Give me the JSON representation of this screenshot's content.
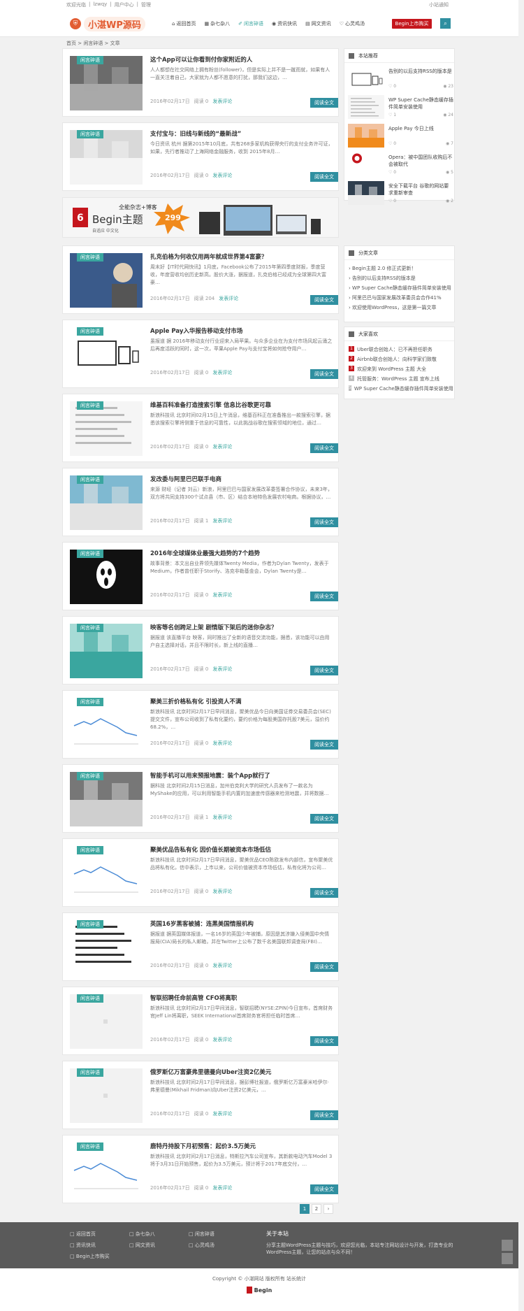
{
  "topbar": {
    "links": [
      "欢迎光临",
      "|",
      "lzwqy",
      "|",
      "用户中心",
      "|",
      "管理"
    ],
    "right": "小站通知"
  },
  "brand": {
    "logo_text": "小湛WP源码",
    "shield": "⛨"
  },
  "nav": [
    {
      "label": "返回首页",
      "icon": "⌂",
      "active": false
    },
    {
      "label": "杂七杂八",
      "icon": "▦",
      "active": false
    },
    {
      "label": "闲言碎语",
      "icon": "✐",
      "active": true
    },
    {
      "label": "资讯快讯",
      "icon": "◉",
      "active": false
    },
    {
      "label": "网文资讯",
      "icon": "▤",
      "active": false
    },
    {
      "label": "心灵鸡汤",
      "icon": "♡",
      "active": false
    }
  ],
  "buy_button": "Begin上市购买",
  "search_icon": "⌕",
  "breadcrumb": "首页 > 闲言碎语 > 文章",
  "posts": [
    {
      "cat": "闲言碎语",
      "title": "这个App可以让你看到付你家附近的人",
      "excerpt": "人人都想在社交网络上拥有粉丝(follower)，但是实际上并不是一蹴而就，如果有人一直关注着自己，大家就为人都不愿意的打扰，那我们这边，…",
      "date": "2016年02月17日",
      "reads": "阅读 0",
      "comments": "发表评论",
      "more": "阅读全文",
      "thumb": "crowd"
    },
    {
      "cat": "闲言碎语",
      "title": "支付宝与：旧线与新线的“最新战”",
      "excerpt": "今日资讯 杭州 据第2015年10月底，共有268多家机构获得央行的支付业务许可证，如果，先行者推动了上海网络金融服务，收到 2015年8月…",
      "date": "2016年02月17日",
      "reads": "阅读 0",
      "comments": "发表评论",
      "more": "阅读全文",
      "thumb": "hand"
    },
    {
      "cat": "闲言碎语",
      "title": "扎克伯格为何收仅用两年就成世界第4富豪？",
      "excerpt": "周末好【IT时代网快讯】1月底，Facebook公布了2015年第四季度财报，季度营收，年度营收均创历史新高。股价大涨，据报道，扎克伯格已经成为全球第四大富豪…",
      "date": "2016年02月17日",
      "reads": "阅读 204",
      "comments": "发表评论",
      "more": "阅读全文",
      "thumb": "zuck"
    },
    {
      "cat": "闲言碎语",
      "title": "Apple Pay入华报告移动支付市场",
      "excerpt": "虽报道 据 2016年移动支付行业迎来入局苹果。与众多企业在为支付市场风起云涌之后再度活跃的同时，这一次，苹果Apple Pay与支付宝将如何抢夺用户…",
      "date": "2016年02月17日",
      "reads": "阅读 0",
      "comments": "发表评论",
      "more": "阅读全文",
      "thumb": "devices"
    },
    {
      "cat": "闲言碎语",
      "title": "维基百科准备打造搜索引擎 信息比谷歌更可靠",
      "excerpt": "新浪科技讯 北京时间02月15日上午消息，维基百科正在准备推出一款搜索引擎，据悉该搜索引擎将侧重于信息的可靠性，以此挑战谷歌在搜索领域的地位，通过…",
      "date": "2016年02月17日",
      "reads": "阅读 0",
      "comments": "发表评论",
      "more": "阅读全文",
      "thumb": "doc"
    },
    {
      "cat": "闲言碎语",
      "title": "发改委与阿里巴巴联手电商",
      "excerpt": "来源 财经（记者 刘云）新浪，阿里巴巴与国家发展改革委签署合作协议，未来3年，双方将共同支持300个试点县（市、区）结合本地特色发展农村电商。根据协议，…",
      "date": "2016年02月17日",
      "reads": "阅读 1",
      "comments": "发表评论",
      "more": "阅读全文",
      "thumb": "map"
    },
    {
      "cat": "闲言碎语",
      "title": "2016年全球媒体业最强大趋势的7个趋势",
      "excerpt": "故事背景：本文出自业界领先媒体Twenty Media，作者为Dylan Twenty，发表于 Medium，作者曾任职于Storify、洛克非勒基金会，Dylan Twenty是…",
      "date": "2016年02月17日",
      "reads": "阅读 0",
      "comments": "发表评论",
      "more": "阅读全文",
      "thumb": "scream"
    },
    {
      "cat": "闲言碎语",
      "title": "映客等名创跨足上架 剧情版下架后的迷你杂志？",
      "excerpt": "据报道 该直播平台 映客，同时推出了全新的语音交流功能，据悉，该功能可以由用户自主选择对话，并且不限时长，新上线的直播…",
      "date": "2016年02月17日",
      "reads": "阅读 0",
      "comments": "发表评论",
      "more": "阅读全文",
      "thumb": "yingke"
    },
    {
      "cat": "闲言碎语",
      "title": "聚美三折价格私有化 引投资人不满",
      "excerpt": "新浪科技讯 北京时间2月17日早间消息，聚美优品今日向美国证券交易委员会(SEC)提交文件，宣布公司收到了私有化要约，要约价格为每股美国存托股7美元，溢价约68.2%，…",
      "date": "2016年02月17日",
      "reads": "阅读 0",
      "comments": "发表评论",
      "more": "阅读全文",
      "thumb": "stock"
    },
    {
      "cat": "闲言碎语",
      "title": "智能手机可以用来预报地震：装个App就行了",
      "excerpt": "据科技 北京时间2月15日消息，加州伯克利大学的研究人员发布了一款名为MyShake的应用，可以利用智能手机内置的加速度传感器来检测地震，并将数据…",
      "date": "2016年02月17日",
      "reads": "阅读 1",
      "comments": "发表评论",
      "more": "阅读全文",
      "thumb": "city"
    },
    {
      "cat": "闲言碎语",
      "title": "聚美优品告私有化 因价值长期被资本市场低估",
      "excerpt": "新浪科技讯 北京时间2月17日早间消息，聚美优品CEO陈欧发布内部信，宣布聚美优品将私有化，信中表示，上市以来，公司价值被资本市场低估，私有化将为公司…",
      "date": "2016年02月17日",
      "reads": "阅读 0",
      "comments": "发表评论",
      "more": "阅读全文",
      "thumb": "stock2"
    },
    {
      "cat": "闲言碎语",
      "title": "英国16岁黑客被捕：连黑美国情报机构",
      "excerpt": "据报道 据英国媒体报道，一名16岁的英国少年被捕，原因是其涉嫌入侵美国中央情报局(CIA)局长的私人邮箱，并在Twitter上公布了数千名美国联邦调查局(FBI)…",
      "date": "2016年02月17日",
      "reads": "阅读 0",
      "comments": "发表评论",
      "more": "阅读全文",
      "thumb": "text"
    },
    {
      "cat": "闲言碎语",
      "title": "智联招聘任命前高管 CFO将离职",
      "excerpt": "新浪科技讯 北京时间2月17日早间消息，智联招聘(NYSE:ZPIN)今日宣布，首席财务官Jeff Lin将离职，SEEK International首席财务官将担任临时首席…",
      "date": "2016年02月17日",
      "reads": "阅读 0",
      "comments": "发表评论",
      "more": "阅读全文",
      "thumb": "blank"
    },
    {
      "cat": "闲言碎语",
      "title": "俄罗斯亿万富豪弗里德曼向Uber注资2亿美元",
      "excerpt": "新浪科技讯 北京时间2月17日早间消息，据彭博社报道，俄罗斯亿万富豪米哈伊尔·弗里德曼(Mikhail Fridman)向Uber注资2亿美元，…",
      "date": "2016年02月17日",
      "reads": "阅读 0",
      "comments": "发表评论",
      "more": "阅读全文",
      "thumb": "blank"
    },
    {
      "cat": "闲言碎语",
      "title": "鹿特丹持股下月初预售：起价3.5万美元",
      "excerpt": "新浪科技讯 北京时间2月17日消息，特斯拉汽车公司宣布，其新款电动汽车Model 3将于3月31日开始预售，起价为3.5万美元，预计将于2017年底交付，…",
      "date": "2016年02月17日",
      "reads": "阅读 0",
      "comments": "发表评论",
      "more": "阅读全文",
      "thumb": "stock3"
    }
  ],
  "banner": {
    "brand": "Begin主题",
    "line1": "全能杂志+博客",
    "price": "299",
    "sub": "自适应 中文化"
  },
  "widgets": {
    "hot": {
      "title": "本站推荐",
      "items": [
        {
          "title": "告别的以后支持RSS的版本是",
          "likes": "0",
          "views": "23",
          "thumb": "devices"
        },
        {
          "title": "WP Super Cache静态缓存插件简单安装使用",
          "likes": "1",
          "views": "24",
          "thumb": "doc"
        },
        {
          "title": "Apple Pay 今日上线",
          "likes": "0",
          "views": "7",
          "thumb": "pay"
        },
        {
          "title": "Opera：被中国团队收购后不会被取代",
          "likes": "0",
          "views": "5",
          "thumb": "opera"
        },
        {
          "title": "安全下载平台 谷歌的网站要求重新审查",
          "likes": "0",
          "views": "2",
          "thumb": "site"
        }
      ]
    },
    "random": {
      "title": "分类文章",
      "items": [
        "Begin主题 2.0 修正式更新！",
        "告别的以后支持RSS的版本是",
        "WP Super Cache静态缓存插件简单安装使用",
        "阿里巴巴与国家发展改革委员会合作41%",
        "欢迎使用WordPress，这是第一篇文章"
      ]
    },
    "hotc": {
      "title": "大家喜欢",
      "items": [
        {
          "n": "1",
          "t": "Uber联合创始人：已不再担任职务"
        },
        {
          "n": "2",
          "t": "Airbnb联合创始人：向科学家们致敬"
        },
        {
          "n": "3",
          "t": "欢迎来到 WordPress 主题 大全"
        },
        {
          "n": "4",
          "t": "托管服务：WordPress 主题 宣布上线"
        },
        {
          "n": "5",
          "t": "WP Super Cache静态缓存插件简单安装使用"
        }
      ]
    }
  },
  "pager": [
    "1",
    "2",
    "›"
  ],
  "footer": {
    "links": [
      "返回首页",
      "杂七杂八",
      "闲言碎语",
      "资讯快讯",
      "网文资讯",
      "心灵鸡汤",
      "Begin上市购买"
    ],
    "about_title": "关于本站",
    "about_text": "分享主题WordPress主题与技巧，欢迎您光临，本站专注网站设计与开发，打造专业的WordPress主题，让您的站点与众不同！",
    "copyright": "Copyright ©  小湛网站  版权所有  站长统计",
    "begin": "Begin"
  },
  "colors": {
    "accent": "#3aa69f",
    "button": "#2f8fa0",
    "buy": "#c5161d",
    "footer": "#5a5a5a"
  }
}
